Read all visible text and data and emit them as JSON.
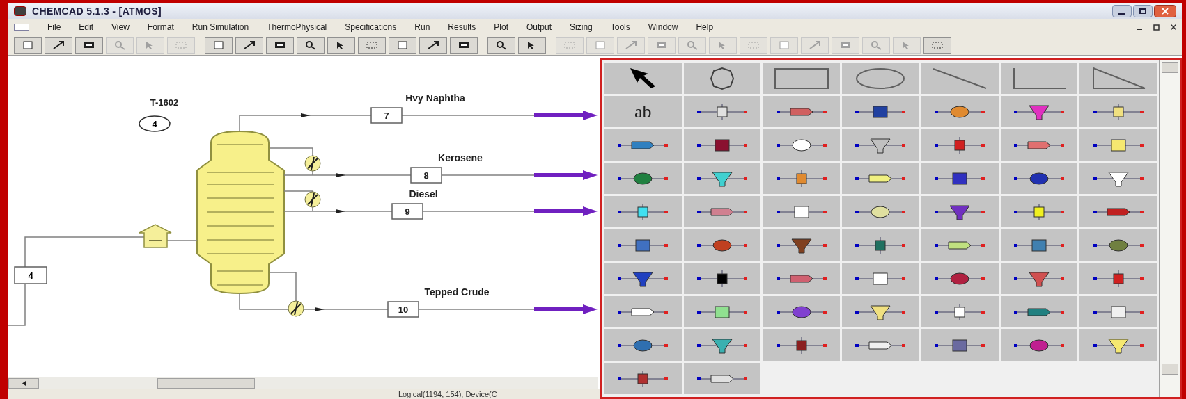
{
  "window": {
    "title": "CHEMCAD 5.1.3 - [ATMOS]"
  },
  "menu": [
    "File",
    "Edit",
    "View",
    "Format",
    "Run Simulation",
    "ThermoPhysical",
    "Specifications",
    "Run",
    "Results",
    "Plot",
    "Output",
    "Sizing",
    "Tools",
    "Window",
    "Help"
  ],
  "toolbar": [
    {
      "disabled": false
    },
    {
      "disabled": false
    },
    {
      "disabled": false
    },
    {
      "disabled": true
    },
    {
      "disabled": true
    },
    {
      "disabled": true
    },
    {
      "disabled": false
    },
    {
      "disabled": false
    },
    {
      "disabled": false
    },
    {
      "disabled": false
    },
    {
      "disabled": false
    },
    {
      "disabled": false
    },
    {
      "disabled": false
    },
    {
      "disabled": false
    },
    {
      "disabled": false
    },
    {
      "disabled": false
    },
    {
      "disabled": false
    },
    {
      "disabled": true
    },
    {
      "disabled": true
    },
    {
      "disabled": true
    },
    {
      "disabled": true
    },
    {
      "disabled": true
    },
    {
      "disabled": true
    },
    {
      "disabled": true
    },
    {
      "disabled": true
    },
    {
      "disabled": true
    },
    {
      "disabled": true
    },
    {
      "disabled": true
    },
    {
      "disabled": true
    },
    {
      "disabled": false
    }
  ],
  "flowsheet": {
    "unit": {
      "name": "T-1602",
      "id": "4"
    },
    "feed": {
      "id": "4"
    },
    "streams": [
      {
        "label": "Hvy Naphtha",
        "id": "7"
      },
      {
        "label": "Kerosene",
        "id": "8"
      },
      {
        "label": "Diesel",
        "id": "9"
      },
      {
        "label": "Tepped Crude",
        "id": "10"
      }
    ]
  },
  "palette": {
    "text_tool": "ab"
  },
  "status_bar": {
    "position": "Logical(1194, 154), Device(C"
  }
}
